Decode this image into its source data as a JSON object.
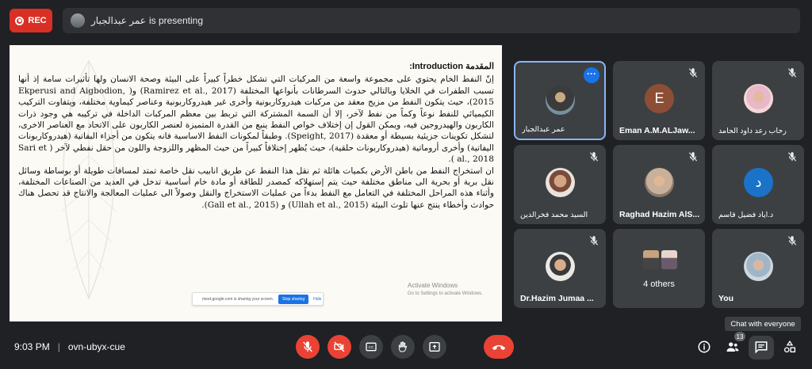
{
  "top": {
    "rec_label": "REC",
    "presenter_name": "عمر عبدالجبار",
    "presenting_suffix": "is presenting"
  },
  "document": {
    "heading": "المقدمة Introduction:",
    "paragraph1": "إنّ النفط الخام يحتوي على مجموعة واسعة من المركبات التي تشكل خطراً كبيراً على البيئة وصحة الانسان ولها تأثيرات سامة إذ أنها تسبب الطفرات في الخلايا وبالتالي حدوث السرطانات بأنواعها المختلفة (Ramirez et al., 2017) و( Ekperusi and Aigbodion, 2015)، حيث يتكون النفط من مزيج معقد من مركبات هيدروكاربونية وأخرى غير هيدروكاربونية وعناصر كيماوية مختلفة، ويتفاوت التركيب الكيميائي للنفط نوعاً وكماً من نفط لآخر، إلا أن السمة المشتركة التي تربط بين معظم المركبات الداخلة في تركيبه هي وجود ذرات الكاربون والهيدروجين فيه، ويمكن القول إن إختلاف خواص النفط ينبع من القدرة المتميزة لعنصر الكاربون على الاتحاد مع العناصر الاخرى، لتشكل تكوينات جزيئية بسيطة أو معقدة (Speight, 2017). وطبقاً لمكونات النفط الاساسية فانه يتكون من أجزاء البفاتية (هيدروكاربونات اليفاتية) وأخرى أروماتية (هيدروكاربونات حلقية)، حيث يُظهر إختلافاً كبيراً من حيث المظهر واللزوجة واللون من حقل نفطي لآخر ( Sari et al., 2018 ).",
    "paragraph2": "ان استخراج النفط من باطن الأرض بكميات هائلة ثم نقل هذا النفط عن طريق انابيب نقل خاصة تمتد لمسافات طويلة أو بوساطة وسائل نقل برية أو بحرية الى مناطق مختلفة حيث يتم إستهلاكه كمصدر للطاقة أو مادة خام أساسية تدخل في العديد من الصناعات المختلفة، وأثناء هذه المراحل المختلفة في التعامل مع النفط بدءاً من عمليات الاستخراج والنقل وصولاً الى عمليات المعالجة والانتاج قد تحصل هناك حوادث وأخطاء ينتج عنها تلوث البيئة (Ullah et al., 2015) و (Gall et al., 2015).",
    "activate_title": "Activate Windows",
    "activate_sub": "Go to Settings to activate Windows.",
    "share_text": "meet.google.com is sharing your screen.",
    "stop_sharing": "Stop sharing",
    "hide": "Hide"
  },
  "participants": [
    {
      "name": "عمر عبدالجبار",
      "type": "photo"
    },
    {
      "name": "Eman A.M.ALJaw...",
      "type": "letter",
      "letter": "E",
      "color": "#8d4e36"
    },
    {
      "name": "رحاب رعد داود الحامد",
      "type": "photo"
    },
    {
      "name": "السيد محمد فخرالدين",
      "type": "photo"
    },
    {
      "name": "Raghad Hazim AlS...",
      "type": "photo"
    },
    {
      "name": "د.اياد فضيل قاسم",
      "type": "letter",
      "letter": "د",
      "color": "#1a73c8"
    },
    {
      "name": "Dr.Hazim Jumaa ...",
      "type": "photo"
    },
    {
      "name": "4 others",
      "type": "group"
    },
    {
      "name": "You",
      "type": "photo"
    }
  ],
  "tooltip": "Chat with everyone",
  "bottom": {
    "time": "9:03 PM",
    "meeting_code": "ovn-ubyx-cue",
    "people_count": "13"
  },
  "icons": {
    "mic": "mic-off-icon",
    "camera": "camera-off-icon",
    "captions": "captions-icon",
    "hand": "raise-hand-icon",
    "present": "present-icon",
    "end": "end-call-icon",
    "info": "info-icon",
    "people": "people-icon",
    "chat": "chat-icon",
    "activities": "activities-icon"
  },
  "colors": {
    "background": "#202124",
    "tile": "#3c4043",
    "danger": "#ea4335",
    "accent": "#8ab4f8"
  }
}
